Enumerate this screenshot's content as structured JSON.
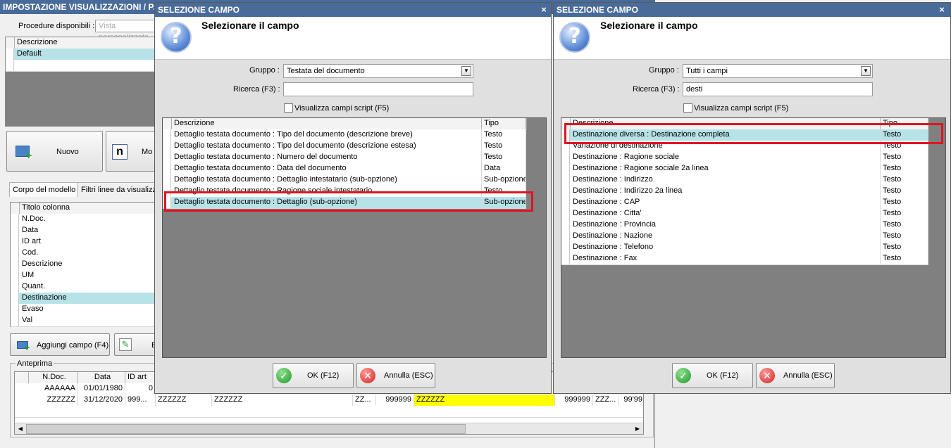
{
  "bg_window": {
    "title": "IMPOSTAZIONE VISUALIZZAZIONI / PARAMETRIZZAZIONE RIEPILOGHI",
    "procedure_label": "Procedure disponibili :",
    "procedure_placeholder": "Vista personalizzata",
    "views_header": "Descrizione",
    "views": [
      "Default"
    ],
    "btn_nuovo": "Nuovo",
    "btn_modifica": "Mo",
    "tabs": [
      "Corpo del modello",
      "Filtri linee da visualizzare"
    ],
    "columns_header": "Titolo colonna",
    "columns": [
      "N.Doc.",
      "Data",
      "ID art",
      "Cod.",
      "Descrizione",
      "UM",
      "Quant.",
      "Destinazione",
      "Evaso",
      "Val"
    ],
    "btn_aggiungi": "Aggiungi campo (F4)",
    "btn_elimina": "E",
    "preview_label": "Anteprima",
    "preview_headers": [
      "N.Doc.",
      "Data",
      "ID art"
    ],
    "preview_rows": [
      [
        "AAAAAA",
        "01/01/1980",
        "0"
      ],
      [
        "ZZZZZZ",
        "31/12/2020",
        "999...",
        "ZZZZZZ",
        "ZZZZZZ",
        "ZZ...",
        "999999",
        "ZZZZZZ",
        "999999",
        "ZZZ...",
        "99'99"
      ]
    ]
  },
  "dialog1": {
    "title": "SELEZIONE CAMPO",
    "heading": "Selezionare il campo",
    "gruppo_label": "Gruppo :",
    "gruppo_value": "Testata del documento",
    "ricerca_label": "Ricerca (F3) :",
    "ricerca_value": "",
    "script_label": "Visualizza campi script (F5)",
    "col_descr": "Descrizione",
    "col_tipo": "Tipo",
    "rows": [
      {
        "d": "Dettaglio testata documento : Tipo del documento (descrizione breve)",
        "t": "Testo"
      },
      {
        "d": "Dettaglio testata documento : Tipo del documento (descrizione estesa)",
        "t": "Testo"
      },
      {
        "d": "Dettaglio testata documento : Numero del documento",
        "t": "Testo"
      },
      {
        "d": "Dettaglio testata documento : Data del documento",
        "t": "Data"
      },
      {
        "d": "Dettaglio testata documento : Dettaglio intestatario (sub-opzione)",
        "t": "Sub-opzione"
      },
      {
        "d": "Dettaglio testata documento : Ragione sociale intestatario",
        "t": "Testo"
      },
      {
        "d": "Dettaglio testata documento : Dettaglio (sub-opzione)",
        "t": "Sub-opzione"
      }
    ],
    "ok": "OK (F12)",
    "cancel": "Annulla (ESC)"
  },
  "dialog2": {
    "title": "SELEZIONE CAMPO",
    "heading": "Selezionare il campo",
    "gruppo_label": "Gruppo :",
    "gruppo_value": "Tutti i campi",
    "ricerca_label": "Ricerca (F3) :",
    "ricerca_value": "desti",
    "script_label": "Visualizza campi script (F5)",
    "col_descr": "Descrizione",
    "col_tipo": "Tipo",
    "rows": [
      {
        "d": "Destinazione diversa : Destinazione completa",
        "t": "Testo"
      },
      {
        "d": "Variazione di destinazione",
        "t": "Testo"
      },
      {
        "d": "Destinazione : Ragione sociale",
        "t": "Testo"
      },
      {
        "d": "Destinazione : Ragione sociale 2a linea",
        "t": "Testo"
      },
      {
        "d": "Destinazione : Indirizzo",
        "t": "Testo"
      },
      {
        "d": "Destinazione : Indirizzo 2a linea",
        "t": "Testo"
      },
      {
        "d": "Destinazione : CAP",
        "t": "Testo"
      },
      {
        "d": "Destinazione : Citta'",
        "t": "Testo"
      },
      {
        "d": "Destinazione : Provincia",
        "t": "Testo"
      },
      {
        "d": "Destinazione : Nazione",
        "t": "Testo"
      },
      {
        "d": "Destinazione : Telefono",
        "t": "Testo"
      },
      {
        "d": "Destinazione : Fax",
        "t": "Testo"
      }
    ],
    "ok": "OK (F12)",
    "cancel": "Annulla (ESC)"
  },
  "colors": {
    "title_bg": "#486b9a",
    "selected_row": "#b7e3e8",
    "highlight": "#e0141e",
    "preview_yellow": "#ffff00"
  }
}
